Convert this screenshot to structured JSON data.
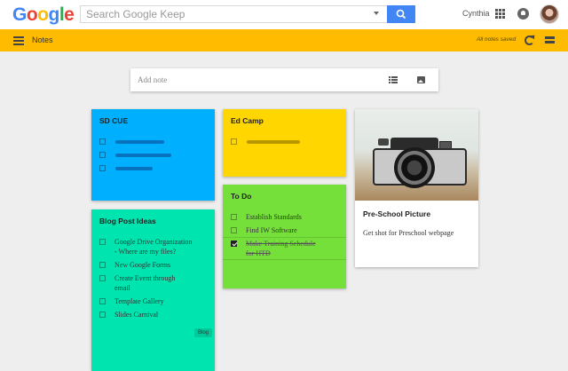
{
  "brand": {
    "logo_letters": [
      "G",
      "o",
      "o",
      "g",
      "l",
      "e"
    ],
    "logo_colors": [
      "#4285f4",
      "#ea4335",
      "#fbbc05",
      "#4285f4",
      "#34a853",
      "#ea4335"
    ]
  },
  "search": {
    "placeholder": "Search Google Keep",
    "value": ""
  },
  "user": {
    "name": "Cynthia"
  },
  "appbar": {
    "title": "Notes",
    "save_status": "All notes saved",
    "color": "#ffbb00"
  },
  "add_note": {
    "placeholder": "Add note"
  },
  "notes": {
    "sd_cue": {
      "title": "SD CUE",
      "color": "#00b0ff"
    },
    "ed_camp": {
      "title": "Ed Camp",
      "color": "#ffd600"
    },
    "todo": {
      "title": "To Do",
      "color": "#76e03a",
      "items": [
        {
          "text": "Establish Standards",
          "checked": false
        },
        {
          "text": "Find IW Software",
          "checked": false
        },
        {
          "text": "Make Training Schedule",
          "text2": "for HTD",
          "checked": true
        }
      ]
    },
    "preschool": {
      "title": "Pre-School Picture",
      "body": "Get shot for Preschool webpage"
    },
    "blog": {
      "title": "Blog Post Ideas",
      "color": "#00e5b0",
      "items": [
        {
          "text": "Google Drive Organization",
          "text2": "- Where are my files?"
        },
        {
          "text": "New Google Forms"
        },
        {
          "text": "Create Event through",
          "text2": "email"
        },
        {
          "text": "Template Gallery"
        },
        {
          "text": "Slides Carnival"
        }
      ],
      "label": "Blog"
    }
  }
}
